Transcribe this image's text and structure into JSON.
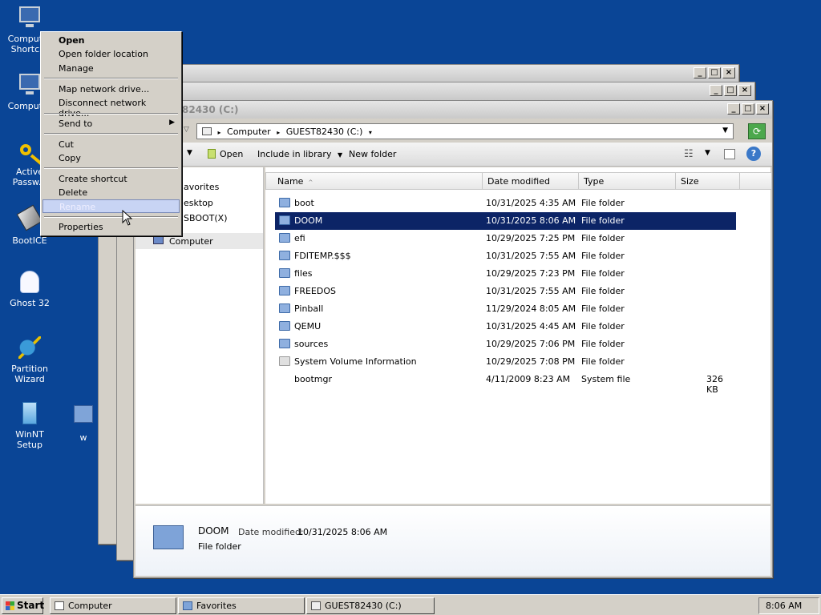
{
  "desktop": {
    "icons": [
      {
        "label": "Computer\nShortcut",
        "icon": "monitor-icon"
      },
      {
        "label": "Computer",
        "icon": "monitor-icon"
      },
      {
        "label": "Active\nPassw...",
        "icon": "key-icon"
      },
      {
        "label": "BootICE",
        "icon": "bootice-icon"
      },
      {
        "label": "Ghost 32",
        "icon": "ghost-icon"
      },
      {
        "label": "Partition\nWizard",
        "icon": "wand-icon"
      },
      {
        "label": "WinNT Setup",
        "icon": "setup-icon"
      },
      {
        "label": "w",
        "icon": "folder-icon"
      }
    ]
  },
  "context_menu": {
    "items": [
      "Open",
      "Open folder location",
      "Manage",
      "Map network drive...",
      "Disconnect network drive...",
      "Send to",
      "Cut",
      "Copy",
      "Create shortcut",
      "Delete",
      "Rename",
      "Properties"
    ]
  },
  "explorer": {
    "title": "GUEST82430 (C:)",
    "title_partial": "82430 (C:)",
    "breadcrumb": [
      "Computer",
      "GUEST82430 (C:)"
    ],
    "toolbar": {
      "open": "Open",
      "include": "Include in library",
      "new_folder": "New folder"
    },
    "nav": {
      "favorites": "avorites",
      "desktop": "esktop",
      "sboot": "SBOOT(X)",
      "computer": "Computer"
    },
    "columns": [
      "Name",
      "Date modified",
      "Type",
      "Size"
    ],
    "files": [
      {
        "name": "boot",
        "date": "10/31/2025 4:35 AM",
        "type": "File folder",
        "size": ""
      },
      {
        "name": "DOOM",
        "date": "10/31/2025 8:06 AM",
        "type": "File folder",
        "size": ""
      },
      {
        "name": "efi",
        "date": "10/29/2025 7:25 PM",
        "type": "File folder",
        "size": ""
      },
      {
        "name": "FDITEMP.$$$",
        "date": "10/31/2025 7:55 AM",
        "type": "File folder",
        "size": ""
      },
      {
        "name": "files",
        "date": "10/29/2025 7:23 PM",
        "type": "File folder",
        "size": ""
      },
      {
        "name": "FREEDOS",
        "date": "10/31/2025 7:55 AM",
        "type": "File folder",
        "size": ""
      },
      {
        "name": "Pinball",
        "date": "11/29/2024 8:05 AM",
        "type": "File folder",
        "size": ""
      },
      {
        "name": "QEMU",
        "date": "10/31/2025 4:45 AM",
        "type": "File folder",
        "size": ""
      },
      {
        "name": "sources",
        "date": "10/29/2025 7:06 PM",
        "type": "File folder",
        "size": ""
      },
      {
        "name": "System Volume Information",
        "date": "10/29/2025 7:08 PM",
        "type": "File folder",
        "size": ""
      },
      {
        "name": "bootmgr",
        "date": "4/11/2009 8:23 AM",
        "type": "System file",
        "size": "326 KB"
      }
    ],
    "selected": "DOOM",
    "details": {
      "name": "DOOM",
      "date_label": "Date modified:",
      "date": "10/31/2025 8:06 AM",
      "type": "File folder"
    }
  },
  "taskbar": {
    "start": "Start",
    "tasks": [
      "Computer",
      "Favorites",
      "GUEST82430 (C:)"
    ],
    "clock": "8:06 AM"
  }
}
